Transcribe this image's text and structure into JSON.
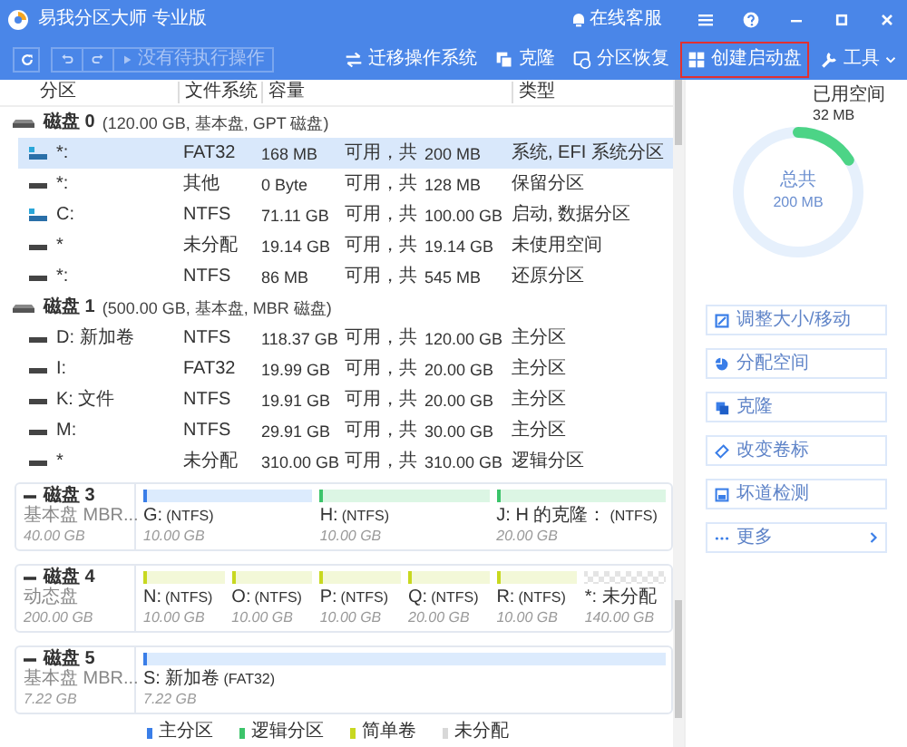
{
  "window": {
    "title": "易我分区大师 专业版",
    "support": "在线客服"
  },
  "toolbar": {
    "pending": {
      "label": "没有待执行操作",
      "disabled": true
    },
    "actions": [
      {
        "label": "迁移操作系统",
        "kind": "migrate",
        "highlighted": false
      },
      {
        "label": "克隆",
        "kind": "clone",
        "highlighted": false
      },
      {
        "label": "分区恢复",
        "kind": "recover",
        "highlighted": false
      },
      {
        "label": "创建启动盘",
        "kind": "boot",
        "highlighted": true
      },
      {
        "label": "工具",
        "kind": "tools",
        "highlighted": false
      }
    ]
  },
  "table": {
    "columns": [
      "分区",
      "文件系统",
      "容量",
      "类型"
    ],
    "disks": [
      {
        "name": "磁盘 0",
        "info": "(120.00 GB, 基本盘, GPT 磁盘)",
        "partitions": [
          {
            "name": "*:",
            "fs": "FAT32",
            "free": "168 MB",
            "mid": "可用，共",
            "total": "200 MB",
            "type": "系统, EFI 系统分区",
            "kind": "system",
            "selected": true
          },
          {
            "name": "*:",
            "fs": "其他",
            "free": "0 Byte",
            "mid": "可用，共",
            "total": "128 MB",
            "type": "保留分区",
            "kind": "plain",
            "selected": false
          },
          {
            "name": "C:",
            "fs": "NTFS",
            "free": "71.11 GB",
            "mid": "可用，共",
            "total": "100.00 GB",
            "type": "启动, 数据分区",
            "kind": "system",
            "selected": false
          },
          {
            "name": "*",
            "fs": "未分配",
            "free": "19.14 GB",
            "mid": "可用，共",
            "total": "19.14 GB",
            "type": "未使用空间",
            "kind": "plain",
            "selected": false
          },
          {
            "name": "*:",
            "fs": "NTFS",
            "free": "86 MB",
            "mid": "可用，共",
            "total": "545 MB",
            "type": "还原分区",
            "kind": "plain",
            "selected": false
          }
        ]
      },
      {
        "name": "磁盘 1",
        "info": "(500.00 GB, 基本盘, MBR 磁盘)",
        "partitions": [
          {
            "name": "D: 新加卷",
            "fs": "NTFS",
            "free": "118.37 GB",
            "mid": "可用，共",
            "total": "120.00 GB",
            "type": "主分区",
            "kind": "plain",
            "selected": false
          },
          {
            "name": "I:",
            "fs": "FAT32",
            "free": "19.99 GB",
            "mid": "可用，共",
            "total": "20.00 GB",
            "type": "主分区",
            "kind": "plain",
            "selected": false
          },
          {
            "name": "K: 文件",
            "fs": "NTFS",
            "free": "19.91 GB",
            "mid": "可用，共",
            "total": "20.00 GB",
            "type": "主分区",
            "kind": "plain",
            "selected": false
          },
          {
            "name": "M:",
            "fs": "NTFS",
            "free": "29.91 GB",
            "mid": "可用，共",
            "total": "30.00 GB",
            "type": "主分区",
            "kind": "plain",
            "selected": false
          },
          {
            "name": "*",
            "fs": "未分配",
            "free": "310.00 GB",
            "mid": "可用，共",
            "total": "310.00 GB",
            "type": "逻辑分区",
            "kind": "plain",
            "selected": false
          }
        ]
      }
    ]
  },
  "disk_map": [
    {
      "name": "磁盘 3",
      "type": "基本盘 MBR...",
      "size": "40.00 GB",
      "parts": [
        {
          "label": "G:",
          "fs": "(NTFS)",
          "size": "10.00 GB",
          "kind": "primary"
        },
        {
          "label": "H:",
          "fs": "(NTFS)",
          "size": "10.00 GB",
          "kind": "logical"
        },
        {
          "label": "J: H 的克隆：",
          "fs": "(NTFS)",
          "size": "20.00 GB",
          "kind": "logical"
        }
      ]
    },
    {
      "name": "磁盘 4",
      "type": "动态盘",
      "size": "200.00 GB",
      "parts": [
        {
          "label": "N:",
          "fs": "(NTFS)",
          "size": "10.00 GB",
          "kind": "simple"
        },
        {
          "label": "O:",
          "fs": "(NTFS)",
          "size": "10.00 GB",
          "kind": "simple"
        },
        {
          "label": "P:",
          "fs": "(NTFS)",
          "size": "10.00 GB",
          "kind": "simple"
        },
        {
          "label": "Q:",
          "fs": "(NTFS)",
          "size": "20.00 GB",
          "kind": "simple"
        },
        {
          "label": "R:",
          "fs": "(NTFS)",
          "size": "10.00 GB",
          "kind": "simple"
        },
        {
          "label": "*: 未分配",
          "size": "140.00 GB",
          "kind": "unallocated"
        }
      ]
    },
    {
      "name": "磁盘 5",
      "type": "基本盘 MBR...",
      "size": "7.22 GB",
      "parts": [
        {
          "label": "S: 新加卷",
          "fs": "(FAT32)",
          "size": "7.22 GB",
          "kind": "primary"
        }
      ]
    }
  ],
  "legend": [
    {
      "label": "主分区",
      "color": "#3a7ee8"
    },
    {
      "label": "逻辑分区",
      "color": "#3cc46a"
    },
    {
      "label": "简单卷",
      "color": "#c8d820"
    },
    {
      "label": "未分配",
      "color": "#d8d8d8"
    }
  ],
  "usage": {
    "used_label": "已用空间",
    "used": "32 MB",
    "total_label": "总共",
    "total": "200 MB",
    "level": 0.16
  },
  "side_actions": [
    {
      "label": "调整大小/移动",
      "kind": "resize"
    },
    {
      "label": "分配空间",
      "kind": "allocate"
    },
    {
      "label": "克隆",
      "kind": "clone"
    },
    {
      "label": "改变卷标",
      "kind": "label"
    },
    {
      "label": "坏道检测",
      "kind": "check"
    },
    {
      "label": "更多",
      "kind": "more"
    }
  ]
}
